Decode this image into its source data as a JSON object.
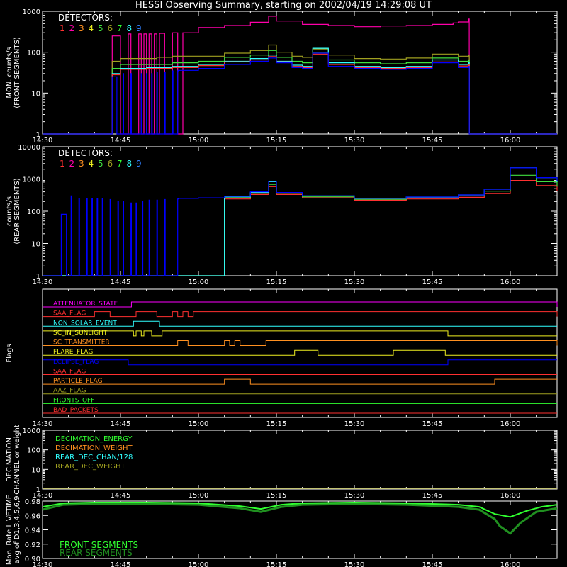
{
  "title": "HESSI Observing Summary, starting on 2002/04/19 14:29:08 UT",
  "x_axis": {
    "start_minutes": 0,
    "end_minutes": 99,
    "ticks": [
      {
        "minutes": 0,
        "label": "14:30"
      },
      {
        "minutes": 15,
        "label": "14:45"
      },
      {
        "minutes": 30,
        "label": "15:00"
      },
      {
        "minutes": 45,
        "label": "15:15"
      },
      {
        "minutes": 60,
        "label": "15:30"
      },
      {
        "minutes": 75,
        "label": "15:45"
      },
      {
        "minutes": 90,
        "label": "16:00"
      }
    ]
  },
  "detector_colors": [
    "#ff3030",
    "#ff00aa",
    "#ff9020",
    "#f0f020",
    "#40e040",
    "#a0a020",
    "#30ff30",
    "#30ffff",
    "#3080ff"
  ],
  "chart_data": [
    {
      "type": "line",
      "id": "front",
      "ylabel": "MON. counts/s\n(FRONT SEGMENTS)",
      "yscale": "log",
      "ylim": [
        1,
        1000
      ],
      "yticks": [
        {
          "v": 1,
          "label": "1"
        },
        {
          "v": 10,
          "label": "10"
        },
        {
          "v": 100,
          "label": "100"
        },
        {
          "v": 1000,
          "label": "1000"
        }
      ],
      "legend_title": "DETECTORS:",
      "legend_items": [
        "1",
        "2",
        "3",
        "4",
        "5",
        "6",
        "7",
        "8",
        "9"
      ],
      "series": [
        {
          "color": "#ff00aa",
          "x": [
            0,
            13.2,
            13.4,
            14.5,
            15.0,
            16.5,
            17.0,
            18.5,
            19,
            19.5,
            20,
            20.5,
            21,
            21.5,
            22,
            22.5,
            23.5,
            25,
            26,
            27,
            30,
            35,
            40,
            43.5,
            45,
            50,
            55,
            60,
            65,
            70,
            75,
            79,
            80,
            82,
            82.1,
            99
          ],
          "y": [
            1,
            1,
            250,
            250,
            1,
            280,
            1,
            280,
            1,
            280,
            1,
            280,
            1,
            280,
            1,
            290,
            1,
            300,
            1,
            300,
            400,
            450,
            540,
            760,
            580,
            480,
            450,
            420,
            440,
            450,
            480,
            520,
            550,
            650,
            1,
            1
          ]
        },
        {
          "color": "#a0a020",
          "x": [
            0,
            13.2,
            13.4,
            15,
            20,
            22,
            25,
            26,
            30,
            35,
            40,
            43.5,
            45,
            48,
            50,
            52,
            55,
            60,
            65,
            70,
            75,
            80,
            82,
            82.1,
            99
          ],
          "y": [
            1,
            1,
            60,
            70,
            70,
            75,
            80,
            80,
            80,
            95,
            110,
            150,
            100,
            80,
            75,
            120,
            85,
            70,
            68,
            72,
            90,
            80,
            85,
            1,
            1
          ]
        },
        {
          "color": "#40e040",
          "x": [
            0,
            13.2,
            13.4,
            15,
            20,
            25,
            30,
            35,
            40,
            43.5,
            45,
            48,
            50,
            52,
            55,
            60,
            65,
            70,
            75,
            80,
            82,
            82.1,
            99
          ],
          "y": [
            1,
            1,
            40,
            50,
            50,
            55,
            60,
            75,
            85,
            110,
            75,
            60,
            55,
            100,
            65,
            55,
            52,
            55,
            72,
            60,
            65,
            1,
            1
          ]
        },
        {
          "color": "#30ffff",
          "x": [
            0,
            13.2,
            13.4,
            15,
            20,
            25,
            30,
            35,
            40,
            43.5,
            45,
            48,
            50,
            52,
            55,
            60,
            65,
            70,
            75,
            80,
            82,
            82.1,
            99
          ],
          "y": [
            1,
            1,
            30,
            40,
            42,
            45,
            50,
            60,
            70,
            85,
            60,
            48,
            45,
            125,
            55,
            45,
            42,
            45,
            65,
            50,
            55,
            1,
            1
          ]
        },
        {
          "color": "#ff3030",
          "x": [
            0,
            13.2,
            13.4,
            15,
            20,
            25,
            30,
            35,
            40,
            43.5,
            45,
            48,
            50,
            52,
            55,
            60,
            65,
            70,
            75,
            80,
            82,
            82.1,
            99
          ],
          "y": [
            1,
            1,
            28,
            38,
            40,
            42,
            47,
            58,
            65,
            78,
            58,
            45,
            42,
            90,
            50,
            42,
            40,
            42,
            58,
            46,
            50,
            1,
            1
          ]
        },
        {
          "color": "#0000ff",
          "x": [
            0,
            13.2,
            13.4,
            14.2,
            14.3,
            15.5,
            15.6,
            17,
            17.1,
            19,
            19.1,
            20,
            20.1,
            21,
            21.1,
            22,
            22.1,
            23.5,
            23.6,
            25,
            25.1,
            26,
            26.1,
            30,
            35,
            40,
            43.5,
            45,
            48,
            50,
            52,
            55,
            60,
            65,
            70,
            75,
            80,
            82,
            82.1,
            99
          ],
          "y": [
            1,
            1,
            25,
            25,
            1,
            30,
            1,
            30,
            1,
            30,
            1,
            30,
            1,
            30,
            1,
            32,
            1,
            32,
            1,
            35,
            1,
            35,
            36,
            40,
            50,
            60,
            72,
            55,
            42,
            40,
            95,
            45,
            40,
            38,
            40,
            55,
            42,
            45,
            1,
            1
          ]
        }
      ]
    },
    {
      "type": "line",
      "id": "rear",
      "ylabel": "counts/s\n(REAR SEGMENTS)",
      "yscale": "log",
      "ylim": [
        1,
        10000
      ],
      "yticks": [
        {
          "v": 1,
          "label": "1"
        },
        {
          "v": 10,
          "label": "10"
        },
        {
          "v": 100,
          "label": "100"
        },
        {
          "v": 1000,
          "label": "1000"
        },
        {
          "v": 10000,
          "label": "10000"
        }
      ],
      "legend_title": "DETECTORS:",
      "legend_items": [
        "1",
        "2",
        "3",
        "4",
        "5",
        "6",
        "7",
        "8",
        "9"
      ],
      "series": [
        {
          "color": "#ff3030",
          "x": [
            0,
            3.5,
            35,
            40,
            43.5,
            45,
            50,
            60,
            70,
            80,
            85,
            90,
            95,
            99
          ],
          "y": [
            1,
            1,
            240,
            330,
            580,
            330,
            260,
            220,
            240,
            270,
            350,
            900,
            620,
            420
          ]
        },
        {
          "color": "#40e040",
          "x": [
            0,
            3.5,
            35,
            40,
            43.5,
            45,
            50,
            60,
            70,
            80,
            85,
            90,
            95,
            99
          ],
          "y": [
            1,
            1,
            260,
            360,
            680,
            360,
            280,
            235,
            260,
            300,
            420,
            1300,
            820,
            580
          ]
        },
        {
          "color": "#30ffff",
          "x": [
            0,
            3.5,
            35,
            40,
            43.5,
            45,
            50,
            60,
            70,
            80,
            85,
            90,
            95,
            99
          ],
          "y": [
            1,
            1,
            280,
            380,
            820,
            380,
            300,
            250,
            275,
            320,
            480,
            2200,
            1100,
            800
          ]
        },
        {
          "color": "#0000ff",
          "x": [
            0,
            3.5,
            3.6,
            4.5,
            4.6,
            5.5,
            5.6,
            7,
            7.1,
            8.5,
            8.6,
            9.5,
            9.6,
            10.5,
            10.6,
            11.5,
            11.6,
            13,
            13.1,
            14.5,
            14.6,
            15.5,
            15.6,
            17,
            17.1,
            18,
            18.1,
            19.2,
            19.3,
            20.5,
            20.6,
            22,
            22.1,
            23.5,
            23.6,
            26,
            26.1,
            30,
            35,
            40,
            43.5,
            45,
            50,
            60,
            70,
            80,
            85,
            90,
            95,
            99
          ],
          "y": [
            1,
            1,
            80,
            80,
            1,
            300,
            1,
            250,
            1,
            250,
            1,
            250,
            1,
            250,
            1,
            250,
            1,
            230,
            1,
            200,
            1,
            200,
            1,
            180,
            1,
            180,
            1,
            200,
            1,
            220,
            1,
            220,
            1,
            230,
            1,
            240,
            250,
            260,
            290,
            400,
            850,
            380,
            300,
            250,
            275,
            320,
            480,
            2200,
            1100,
            850
          ]
        }
      ]
    },
    {
      "type": "line",
      "id": "flags",
      "ylabel": "Flags",
      "flags": [
        {
          "name": "ATTENUATOR_STATE",
          "color": "#ff00ff",
          "x": [
            0,
            17,
            17.1,
            23,
            99
          ],
          "y": [
            0,
            0,
            1,
            1,
            0
          ]
        },
        {
          "name": "SAA_FLAG",
          "color": "#ff3030",
          "x": [
            0,
            10,
            13,
            18,
            22,
            25,
            26,
            27,
            28,
            29,
            99
          ],
          "y": [
            0,
            1,
            0,
            1,
            0,
            1,
            0,
            1,
            0,
            1,
            0
          ]
        },
        {
          "name": "NON_SOLAR_EVENT",
          "color": "#30ffff",
          "x": [
            0,
            17.5,
            22.5,
            99
          ],
          "y": [
            0,
            1,
            0,
            0
          ]
        },
        {
          "name": "SC_IN_SUNLIGHT",
          "color": "#f0f020",
          "x": [
            0,
            16.5,
            17.5,
            18,
            19,
            19.5,
            21,
            23,
            78,
            99
          ],
          "y": [
            1,
            1,
            0,
            1,
            0,
            1,
            0,
            1,
            0,
            0
          ]
        },
        {
          "name": "SC_TRANSMITTER",
          "color": "#ff9020",
          "x": [
            0,
            26,
            28,
            35,
            36,
            37,
            38,
            43,
            99
          ],
          "y": [
            0,
            1,
            0,
            1,
            0,
            1,
            0,
            1,
            0
          ]
        },
        {
          "name": "FLARE_FLAG",
          "color": "#f0f020",
          "x": [
            0,
            48.5,
            53,
            67.5,
            77.5,
            99
          ],
          "y": [
            0,
            1,
            0,
            1,
            0,
            0
          ]
        },
        {
          "name": "ECLIPSE_FLAG",
          "color": "#0000ff",
          "x": [
            0,
            16.5,
            78,
            99
          ],
          "y": [
            1,
            0,
            1,
            1
          ]
        },
        {
          "name": "SAA_FLAG",
          "color": "#ff3030",
          "x": [
            0,
            99
          ],
          "y": [
            0,
            0
          ]
        },
        {
          "name": "PARTICLE_FLAG",
          "color": "#ff9020",
          "x": [
            0,
            35,
            40,
            87,
            99
          ],
          "y": [
            0,
            1,
            0,
            1,
            1
          ]
        },
        {
          "name": "AAZ_FLAG",
          "color": "#a0a020",
          "x": [
            0,
            99
          ],
          "y": [
            0,
            0
          ]
        },
        {
          "name": "FRONTS_OFF",
          "color": "#30ff30",
          "x": [
            0,
            99
          ],
          "y": [
            0,
            0
          ]
        },
        {
          "name": "BAD_PACKETS",
          "color": "#ff3030",
          "x": [
            0,
            99
          ],
          "y": [
            0,
            0
          ]
        }
      ]
    },
    {
      "type": "line",
      "id": "decimation",
      "ylabel": "DECIMATION\nCHANNEL or weight",
      "yscale": "log",
      "ylim": [
        1,
        1000
      ],
      "yticks": [
        {
          "v": 1,
          "label": "1"
        },
        {
          "v": 10,
          "label": "10"
        },
        {
          "v": 100,
          "label": "100"
        },
        {
          "v": 1000,
          "label": "1000"
        }
      ],
      "legend_items": [
        {
          "name": "DECIMATION_ENERGY",
          "color": "#30ff30"
        },
        {
          "name": "DECIMATION_WEIGHT",
          "color": "#ff9020"
        },
        {
          "name": "REAR_DEC_CHAN/128",
          "color": "#30ffff"
        },
        {
          "name": "REAR_DEC_WEIGHT",
          "color": "#a0a020"
        }
      ]
    },
    {
      "type": "line",
      "id": "livetime",
      "ylabel": "Mon. Rate LIVETIME\navg of D1,3,4,5,6,9",
      "yscale": "linear",
      "ylim": [
        0.9,
        0.98
      ],
      "yticks": [
        {
          "v": 0.9,
          "label": "0.90"
        },
        {
          "v": 0.92,
          "label": "0.92"
        },
        {
          "v": 0.94,
          "label": "0.94"
        },
        {
          "v": 0.96,
          "label": "0.96"
        },
        {
          "v": 0.98,
          "label": "0.98"
        }
      ],
      "legend_items": [
        {
          "name": "FRONT SEGMENTS",
          "color": "#30ff30"
        },
        {
          "name": "REAR SEGMENTS",
          "color": "#209020"
        }
      ],
      "series": [
        {
          "name": "REAR SEGMENTS",
          "color": "#209020",
          "x": [
            0,
            4,
            10,
            20,
            30,
            38,
            42,
            46,
            50,
            60,
            70,
            80,
            84,
            87,
            88,
            90,
            92,
            95,
            99
          ],
          "y": [
            0.968,
            0.975,
            0.976,
            0.976,
            0.975,
            0.97,
            0.965,
            0.972,
            0.975,
            0.976,
            0.975,
            0.972,
            0.968,
            0.955,
            0.945,
            0.935,
            0.95,
            0.965,
            0.97
          ]
        },
        {
          "name": "FRONT SEGMENTS",
          "color": "#30ff30",
          "x": [
            0,
            4,
            10,
            20,
            30,
            38,
            42,
            46,
            50,
            60,
            70,
            80,
            84,
            87,
            90,
            93,
            96,
            99
          ],
          "y": [
            0.972,
            0.977,
            0.978,
            0.978,
            0.977,
            0.973,
            0.969,
            0.975,
            0.977,
            0.978,
            0.977,
            0.975,
            0.972,
            0.962,
            0.958,
            0.966,
            0.972,
            0.975
          ]
        }
      ]
    }
  ]
}
